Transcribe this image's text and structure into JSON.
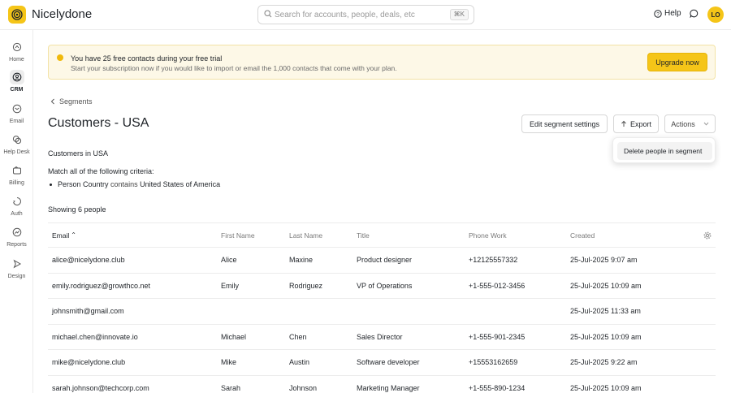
{
  "app": {
    "brand": "Nicelydone",
    "search_placeholder": "Search for accounts, people, deals, etc",
    "search_shortcut": "⌘K",
    "help_label": "Help",
    "avatar_initials": "LO",
    "accent_color": "#f5c518"
  },
  "sidebar": {
    "items": [
      {
        "label": "Home",
        "icon": "home-icon"
      },
      {
        "label": "CRM",
        "icon": "crm-icon",
        "active": true
      },
      {
        "label": "Email",
        "icon": "email-icon"
      },
      {
        "label": "Help Desk",
        "icon": "help-desk-icon"
      },
      {
        "label": "Billing",
        "icon": "billing-icon"
      },
      {
        "label": "Auth",
        "icon": "auth-icon"
      },
      {
        "label": "Reports",
        "icon": "reports-icon"
      },
      {
        "label": "Design",
        "icon": "design-icon"
      }
    ]
  },
  "banner": {
    "title": "You have 25 free contacts during your free trial",
    "subtitle": "Start your subscription now if you would like to import or email the 1,000 contacts that come with your plan.",
    "cta": "Upgrade now"
  },
  "breadcrumb": {
    "back_label": "Segments"
  },
  "page": {
    "title": "Customers - USA",
    "edit_button": "Edit segment settings",
    "export_button": "Export",
    "actions_button": "Actions",
    "actions_menu": [
      "Delete people in segment"
    ],
    "description": "Customers in USA",
    "criteria_heading": "Match all of the following criteria:",
    "criteria": {
      "field": "Person Country",
      "operator": "contains",
      "value": "United States of America"
    },
    "showing": "Showing 6 people"
  },
  "table": {
    "columns": {
      "email": "Email",
      "sort_indicator": "⌃",
      "first": "First Name",
      "last": "Last Name",
      "title": "Title",
      "phone": "Phone Work",
      "created": "Created"
    },
    "rows": [
      {
        "email": "alice@nicelydone.club",
        "first": "Alice",
        "last": "Maxine",
        "title": "Product designer",
        "phone": "+12125557332",
        "created": "25-Jul-2025 9:07 am"
      },
      {
        "email": "emily.rodriguez@growthco.net",
        "first": "Emily",
        "last": "Rodriguez",
        "title": "VP of Operations",
        "phone": "+1-555-012-3456",
        "created": "25-Jul-2025 10:09 am"
      },
      {
        "email": "johnsmith@gmail.com",
        "first": "",
        "last": "",
        "title": "",
        "phone": "",
        "created": "25-Jul-2025 11:33 am"
      },
      {
        "email": "michael.chen@innovate.io",
        "first": "Michael",
        "last": "Chen",
        "title": "Sales Director",
        "phone": "+1-555-901-2345",
        "created": "25-Jul-2025 10:09 am"
      },
      {
        "email": "mike@nicelydone.club",
        "first": "Mike",
        "last": "Austin",
        "title": "Software developer",
        "phone": "+15553162659",
        "created": "25-Jul-2025 9:22 am"
      },
      {
        "email": "sarah.johnson@techcorp.com",
        "first": "Sarah",
        "last": "Johnson",
        "title": "Marketing Manager",
        "phone": "+1-555-890-1234",
        "created": "25-Jul-2025 10:09 am"
      }
    ]
  }
}
